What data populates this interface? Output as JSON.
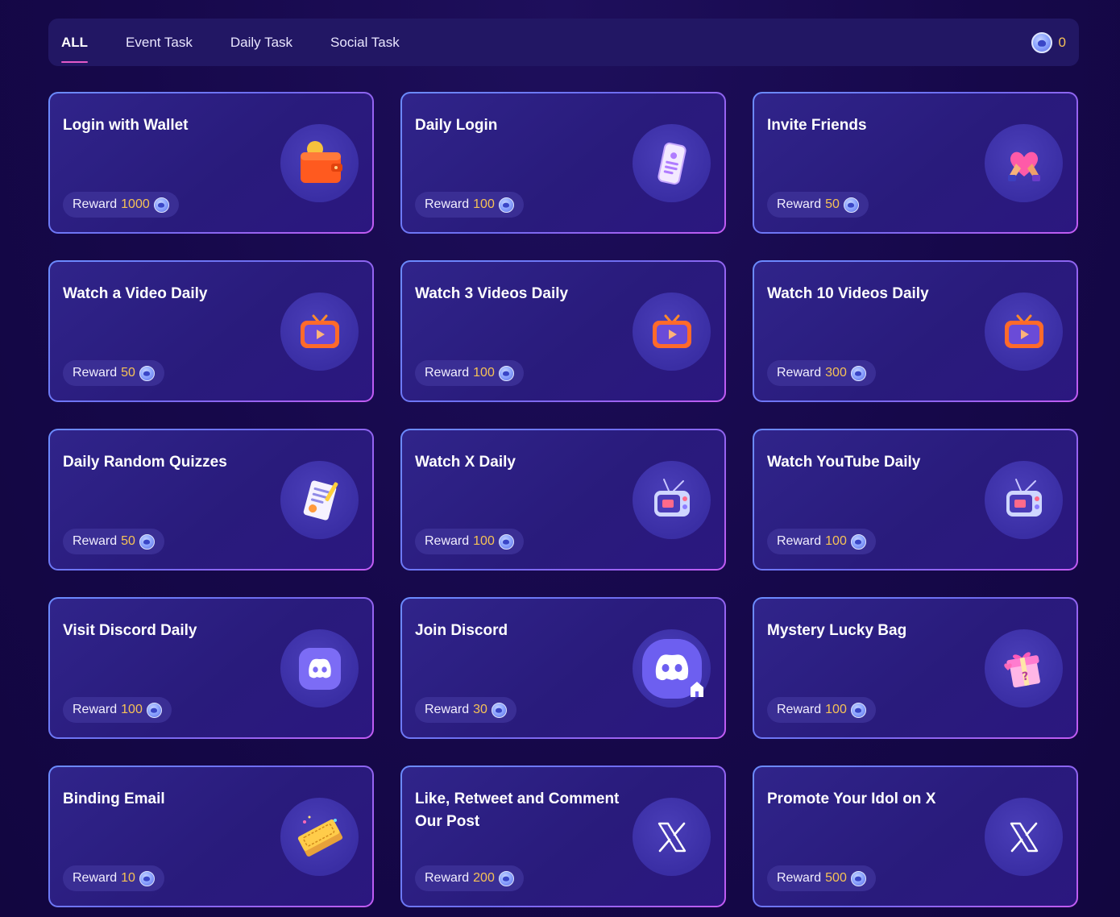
{
  "tabs": [
    {
      "label": "ALL",
      "active": true
    },
    {
      "label": "Event Task",
      "active": false
    },
    {
      "label": "Daily Task",
      "active": false
    },
    {
      "label": "Social Task",
      "active": false
    }
  ],
  "balance": "0",
  "reward_label": "Reward",
  "colors": {
    "accent": "#e45ac8",
    "reward_amount": "#f6c256",
    "card_bg": "#2b1d80",
    "page_bg": "#17084a"
  },
  "tasks": [
    {
      "title": "Login with Wallet",
      "amount": "1000",
      "icon": "wallet-icon"
    },
    {
      "title": "Daily Login",
      "amount": "100",
      "icon": "phone-icon"
    },
    {
      "title": "Invite Friends",
      "amount": "50",
      "icon": "heart-hands-icon"
    },
    {
      "title": "Watch a Video Daily",
      "amount": "50",
      "icon": "tv-play-icon"
    },
    {
      "title": "Watch 3 Videos Daily",
      "amount": "100",
      "icon": "tv-play-icon"
    },
    {
      "title": "Watch 10 Videos Daily",
      "amount": "300",
      "icon": "tv-play-icon"
    },
    {
      "title": "Daily Random Quizzes",
      "amount": "50",
      "icon": "quiz-paper-icon"
    },
    {
      "title": "Watch X Daily",
      "amount": "100",
      "icon": "retro-tv-icon"
    },
    {
      "title": "Watch YouTube Daily",
      "amount": "100",
      "icon": "retro-tv-icon"
    },
    {
      "title": "Visit Discord Daily",
      "amount": "100",
      "icon": "discord-icon"
    },
    {
      "title": "Join Discord",
      "amount": "30",
      "icon": "discord-home-icon"
    },
    {
      "title": "Mystery Lucky Bag",
      "amount": "100",
      "icon": "gift-box-icon"
    },
    {
      "title": "Binding Email",
      "amount": "10",
      "icon": "tickets-icon"
    },
    {
      "title": "Like, Retweet and Comment Our Post",
      "amount": "200",
      "icon": "x-logo-icon"
    },
    {
      "title": "Promote Your Idol on X",
      "amount": "500",
      "icon": "x-logo-icon"
    }
  ]
}
